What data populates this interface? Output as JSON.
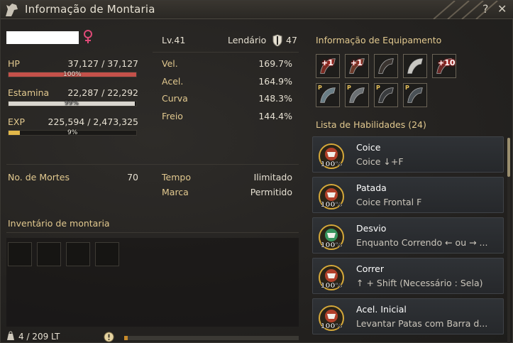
{
  "window": {
    "title": "Informação de Montaria",
    "help": "?",
    "close": "✕"
  },
  "mount": {
    "level": "Lv.41",
    "grade": "Lendário",
    "grade_value": "47",
    "gender_icon": "female-icon"
  },
  "stats": {
    "hp": {
      "label": "HP",
      "value": "37,127 / 37,127",
      "percent_text": "100%",
      "percent": 100,
      "color": "#c4514a"
    },
    "stamina": {
      "label": "Estamina",
      "value": "22,287 / 22,292",
      "percent_text": "99%",
      "percent": 99,
      "color": "#d9d6cf"
    },
    "exp": {
      "label": "EXP",
      "value": "225,594 / 2,473,325",
      "percent_text": "9%",
      "percent": 9,
      "color": "#e2b84a"
    }
  },
  "attributes": [
    {
      "label": "Vel.",
      "value": "169.7%"
    },
    {
      "label": "Acel.",
      "value": "164.9%"
    },
    {
      "label": "Curva",
      "value": "148.3%"
    },
    {
      "label": "Freio",
      "value": "144.4%"
    }
  ],
  "deaths": {
    "label": "No. de Mortes",
    "value": "70"
  },
  "time": {
    "label": "Tempo",
    "value": "Ilimitado"
  },
  "brand": {
    "label": "Marca",
    "value": "Permitido"
  },
  "inventory": {
    "title": "Inventário de montaria",
    "weight": "4 / 209 LT",
    "fill_percent": 2
  },
  "equipment": {
    "title": "Informação de Equipamento",
    "items": [
      {
        "badge": "+1",
        "icon": "saddle-icon"
      },
      {
        "badge": "+1",
        "icon": "barding-icon"
      },
      {
        "badge": "",
        "icon": "stirrups-icon"
      },
      {
        "badge": "",
        "icon": "horseshoe-icon"
      },
      {
        "badge": "+10",
        "icon": "horseshoe-ring-icon"
      },
      {
        "badge": "P",
        "icon": "courser-saddle-icon"
      },
      {
        "badge": "P",
        "icon": "courser-barding-icon"
      },
      {
        "badge": "P",
        "icon": "courser-stirrups-icon"
      },
      {
        "badge": "P",
        "icon": "courser-horseshoe-icon"
      }
    ]
  },
  "skills": {
    "title": "Lista de Habilidades (24)",
    "items": [
      {
        "name": "Coice",
        "desc": "Coice ↓+F",
        "mastery": "100%"
      },
      {
        "name": "Patada",
        "desc": "Coice Frontal F",
        "mastery": "100%"
      },
      {
        "name": "Desvio",
        "desc": "Enquanto Correndo ← ou → ...",
        "mastery": "100%"
      },
      {
        "name": "Correr",
        "desc": "↑ + Shift (Necessário : Sela)",
        "mastery": "100%"
      },
      {
        "name": "Acel. Inicial",
        "desc": "Levantar Patas com Barra d...",
        "mastery": "100%"
      }
    ]
  }
}
